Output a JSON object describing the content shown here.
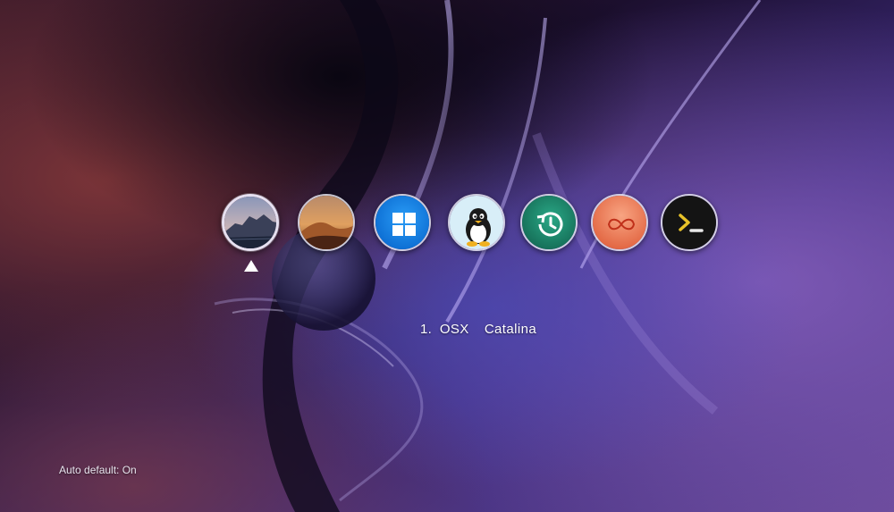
{
  "boot_menu": {
    "entries": [
      {
        "icon": "catalina-island-icon",
        "selected": true
      },
      {
        "icon": "mojave-dunes-icon",
        "selected": false
      },
      {
        "icon": "windows-logo-icon",
        "selected": false
      },
      {
        "icon": "linux-tux-icon",
        "selected": false
      },
      {
        "icon": "time-machine-icon",
        "selected": false
      },
      {
        "icon": "shell-loop-icon",
        "selected": false
      },
      {
        "icon": "terminal-icon",
        "selected": false
      }
    ],
    "selected_label": "1. OSX  Catalina",
    "auto_default": "Auto default: On"
  },
  "colors": {
    "windows_blue": "#0a7ee6",
    "time_machine_green": "#1f8a6e",
    "shell_orange": "#ee7a55",
    "terminal_bg": "#141414",
    "terminal_prompt": "#e8c229"
  }
}
